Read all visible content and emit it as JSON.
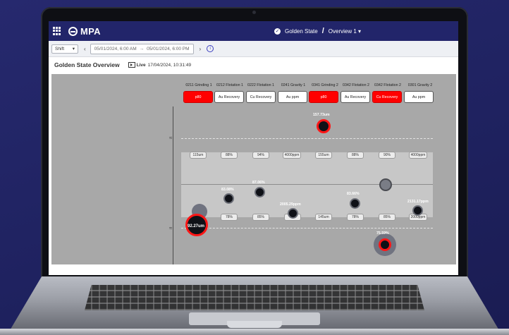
{
  "app": {
    "brand": "MPA",
    "site": "Golden State",
    "view": "Overview 1",
    "view_chevron": "▾"
  },
  "filters": {
    "period": "Shift",
    "period_chevron": "▾",
    "range_start": "05/01/2024, 6:00 AM",
    "range_arrow": "→",
    "range_end": "05/01/2024, 6:00 PM",
    "prev": "‹",
    "next": "›",
    "info": "i"
  },
  "page": {
    "title": "Golden State Overview",
    "live_label": "Live",
    "live_timestamp": "17/04/2024, 10:31:49"
  },
  "columns": [
    {
      "label": "0211 Grinding 1",
      "kpi": "p80",
      "status": "red"
    },
    {
      "label": "0212 Flotation 1",
      "kpi": "Au Recovery",
      "status": "white"
    },
    {
      "label": "0222 Flotation 1",
      "kpi": "Cu Recovery",
      "status": "white"
    },
    {
      "label": "0241 Gravity 1",
      "kpi": "Au ppm",
      "status": "white"
    },
    {
      "label": "0341 Grinding 2",
      "kpi": "p80",
      "status": "red"
    },
    {
      "label": "0342 Flotation 2",
      "kpi": "Au Recovery",
      "status": "white"
    },
    {
      "label": "0342 Flotation 2",
      "kpi": "Cu Recovery",
      "status": "red"
    },
    {
      "label": "0301 Gravity 2",
      "kpi": "Au ppm",
      "status": "white"
    }
  ],
  "upper_limits": [
    "115um",
    "88%",
    "94%",
    "4000ppm",
    "155um",
    "88%",
    "90%",
    "4000ppm"
  ],
  "lower_limits": [
    "",
    "78%",
    "85%",
    "",
    "145um",
    "78%",
    "85%",
    "2000ppm"
  ],
  "values": {
    "grinding1": "92.27um",
    "flotation1_au": "83.08%",
    "flotation1_cu": "87.06%",
    "gravity1": "2005.29ppm",
    "grinding2": "157.73um",
    "flotation2_au": "83.66%",
    "flotation2_cu": "75.59%",
    "gravity2": "2131.17ppm"
  },
  "colors": {
    "header": "#22256a",
    "alert": "#ff0000",
    "canvas": "#a8a8a8",
    "band": "#c7c7c7"
  },
  "icons": {
    "apps": "grid-icon",
    "logo": "mpa-logo-icon",
    "site_status": "check-circle-icon",
    "live": "live-video-icon",
    "info": "info-icon"
  }
}
